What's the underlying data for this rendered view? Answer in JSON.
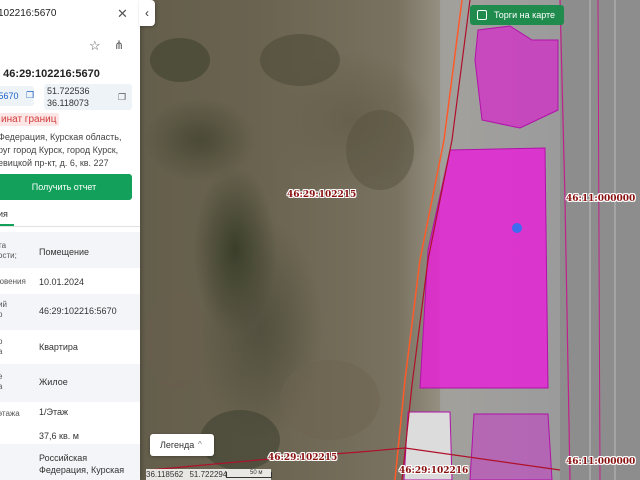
{
  "panel": {
    "top_number": "102216:5670",
    "title": "е 46:29:102216:5670",
    "cad_short": ":5670",
    "coord_lat": "51.722536",
    "coord_lon": "36.118073",
    "error_tag": "инат границ",
    "address_lines": [
      "Федерация, Курская область,",
      "руг город Курск, город Курск,",
      "евицкой пр-кт, д. 6, кв. 227"
    ],
    "get_report_label": "Получить отчет",
    "tab_label": "ия",
    "rows": [
      {
        "label_lines": [
          "та",
          "ости;"
        ],
        "value_lines": [
          "Помещение"
        ]
      },
      {
        "label_lines": [
          "ювения"
        ],
        "value_lines": [
          "10.01.2024"
        ]
      },
      {
        "label_lines": [
          "ий",
          "р"
        ],
        "value_lines": [
          "46:29:102216:5670"
        ]
      },
      {
        "label_lines": [
          "о",
          "а"
        ],
        "value_lines": [
          "Квартира"
        ]
      },
      {
        "label_lines": [
          "е",
          "а"
        ],
        "value_lines": [
          "Жилое"
        ]
      },
      {
        "label_lines": [
          "этажа"
        ],
        "value_lines": [
          "1/Этаж"
        ]
      },
      {
        "label_lines": [
          ""
        ],
        "value_lines": [
          "37,6 кв. м"
        ]
      },
      {
        "label_lines": [
          ""
        ],
        "value_lines": [
          "Российская",
          "Федерация, Курская"
        ]
      }
    ]
  },
  "map": {
    "trade_toggle_label": "Торги на карте",
    "legend_label": "Легенда",
    "legend_chevron": "^",
    "bottom_lon": "36.118562",
    "bottom_lat": "51.722294",
    "scale_label": "50 м",
    "labels": {
      "l1": "46:29:102215",
      "l2": "46:11:000000",
      "l3": "46:29:102215",
      "l4": "46:29:102216",
      "l5": "46:11:000000"
    }
  },
  "colors": {
    "accent_green": "#12a05a",
    "parcel_magenta": "#e81fd8",
    "boundary_red": "#b0102a"
  }
}
